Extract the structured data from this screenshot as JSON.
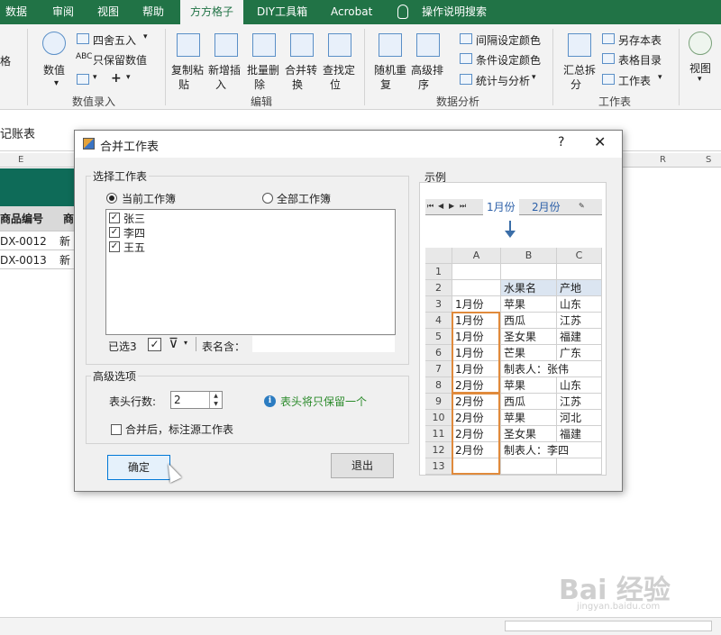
{
  "ribbon": {
    "tabs": [
      "数据",
      "审阅",
      "视图",
      "帮助",
      "方方格子",
      "DIY工具箱",
      "Acrobat",
      "操作说明搜索"
    ],
    "active_tab": "方方格子",
    "groups": {
      "numeric": {
        "label": "数值录入",
        "value_btn": "数值",
        "round": "四舍五入",
        "keep_value": "只保留数值",
        "left_cut": "格"
      },
      "edit": {
        "label": "编辑",
        "copy_paste": [
          "复制粘",
          "贴"
        ],
        "insert": [
          "新增插",
          "入"
        ],
        "batch_delete": [
          "批量删",
          "除"
        ],
        "merge_convert": [
          "合并转",
          "换"
        ],
        "find_locate": [
          "查找定",
          "位"
        ]
      },
      "analysis": {
        "label": "数据分析",
        "random_repeat": [
          "随机重",
          "复"
        ],
        "advanced_sort": [
          "高级排",
          "序"
        ],
        "interval_color": "间隔设定颜色",
        "condition_color": "条件设定颜色",
        "stats": "统计与分析"
      },
      "worksheet": {
        "label": "工作表",
        "summary_split": [
          "汇总拆",
          "分"
        ],
        "save_as": "另存本表",
        "sheet_toc": "表格目录",
        "worksheet": "工作表"
      },
      "view": {
        "label": "视图"
      }
    }
  },
  "sheet": {
    "title_fragment": "记账表",
    "col_e": "E",
    "col_r": "R",
    "col_s": "S",
    "header_cells": [
      "商品编号",
      "商"
    ],
    "rows": [
      [
        "DX-0012",
        "新"
      ],
      [
        "DX-0013",
        "新"
      ]
    ]
  },
  "dialog": {
    "title": "合并工作表",
    "help": "?",
    "close": "✕",
    "select_group": "选择工作表",
    "radio_current": "当前工作簿",
    "radio_all": "全部工作簿",
    "sheets": [
      "张三",
      "李四",
      "王五"
    ],
    "selected_count": "已选3",
    "name_contains_label": "表名含：",
    "advanced_group": "高级选项",
    "header_rows_label": "表头行数:",
    "header_rows_value": "2",
    "info_text": "表头将只保留一个",
    "mark_source_label": "合并后，标注源工作表",
    "ok": "确定",
    "exit": "退出",
    "example_label": "示例",
    "example": {
      "tabs": [
        "1月份",
        "2月份"
      ],
      "col_headers": [
        "A",
        "B",
        "C"
      ],
      "rows": [
        {
          "n": "1",
          "a": "",
          "b": "",
          "c": ""
        },
        {
          "n": "2",
          "a": "",
          "b": "水果名",
          "c": "产地"
        },
        {
          "n": "3",
          "a": "1月份",
          "b": "苹果",
          "c": "山东"
        },
        {
          "n": "4",
          "a": "1月份",
          "b": "西瓜",
          "c": "江苏"
        },
        {
          "n": "5",
          "a": "1月份",
          "b": "圣女果",
          "c": "福建"
        },
        {
          "n": "6",
          "a": "1月份",
          "b": "芒果",
          "c": "广东"
        },
        {
          "n": "7",
          "a": "1月份",
          "b": "制表人：张伟",
          "c": ""
        },
        {
          "n": "8",
          "a": "2月份",
          "b": "苹果",
          "c": "山东"
        },
        {
          "n": "9",
          "a": "2月份",
          "b": "西瓜",
          "c": "江苏"
        },
        {
          "n": "10",
          "a": "2月份",
          "b": "苹果",
          "c": "河北"
        },
        {
          "n": "11",
          "a": "2月份",
          "b": "圣女果",
          "c": "福建"
        },
        {
          "n": "12",
          "a": "2月份",
          "b": "制表人：李四",
          "c": ""
        },
        {
          "n": "13",
          "a": "",
          "b": "",
          "c": ""
        }
      ]
    }
  },
  "watermark": {
    "main": "Bai 经验",
    "sub": "jingyan.baidu.com"
  },
  "colors": {
    "excel_green": "#217346",
    "accent_orange": "#e08a3c",
    "info_blue": "#2c7cc1"
  }
}
